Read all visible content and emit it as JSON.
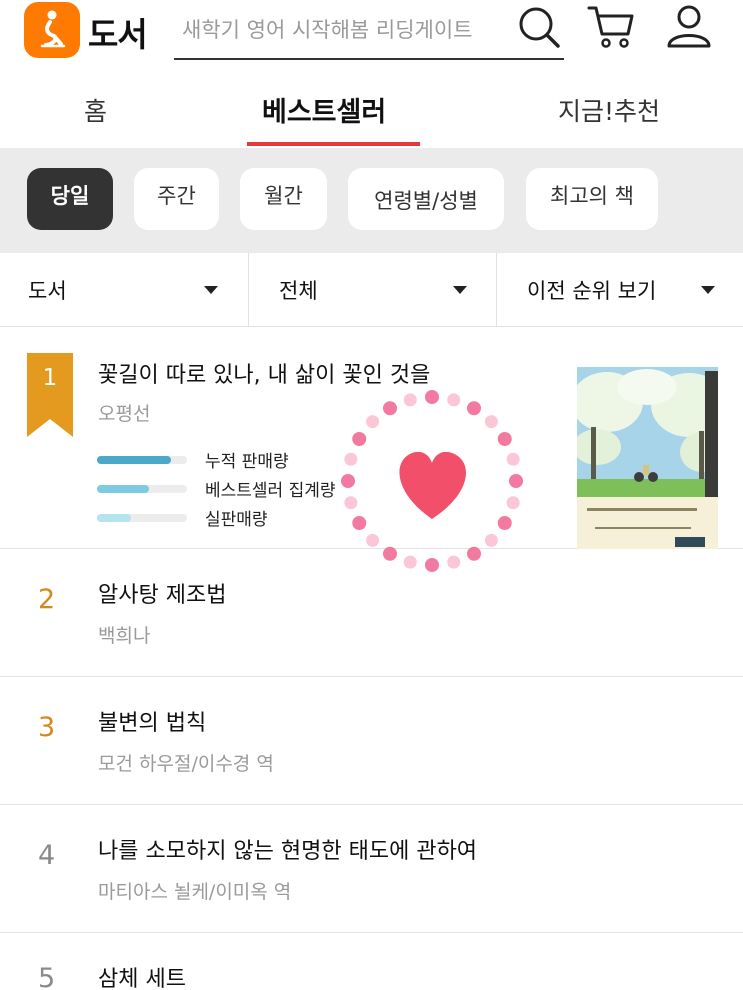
{
  "header": {
    "logo_text": "도서",
    "search_placeholder": "새학기 영어 시작해봄 리딩게이트",
    "icons": [
      "search-icon",
      "cart-icon",
      "user-icon"
    ],
    "brand_color": "#ff7a00"
  },
  "tabs": [
    {
      "label": "홈"
    },
    {
      "label": "베스트셀러",
      "active": true
    },
    {
      "label": "지금!추천"
    }
  ],
  "period_filters": [
    {
      "label": "당일",
      "active": true
    },
    {
      "label": "주간"
    },
    {
      "label": "월간"
    },
    {
      "label": "연령별/성별"
    },
    {
      "label": "최고의 책"
    }
  ],
  "dropdowns": [
    {
      "label": "도서"
    },
    {
      "label": "전체"
    },
    {
      "label": "이전 순위 보기"
    }
  ],
  "books": [
    {
      "rank": "1",
      "title": "꽃길이 따로 있나, 내 삶이 꽃인 것을",
      "author": "오평선"
    },
    {
      "rank": "2",
      "title": "알사탕 제조법",
      "author": "백희나"
    },
    {
      "rank": "3",
      "title": "불변의 법칙",
      "author": "모건 하우절/이수경 역"
    },
    {
      "rank": "4",
      "title": "나를 소모하지 않는 현명한 태도에 관하여",
      "author": "마티아스 뇔케/이미옥 역"
    },
    {
      "rank": "5",
      "title": "삼체 세트",
      "author": ""
    }
  ],
  "first_book_stats": [
    {
      "label": "누적 판매량",
      "fraction": 0.82,
      "color": "#4aa8c8"
    },
    {
      "label": "베스트셀러 집계량",
      "fraction": 0.58,
      "color": "#7dcbe0"
    },
    {
      "label": "실판매량",
      "fraction": 0.38,
      "color": "#b5e3ef"
    }
  ],
  "colors": {
    "accent_red": "#e23a3a",
    "rank_gold": "#d18a1c",
    "heart": "#f2506a"
  }
}
